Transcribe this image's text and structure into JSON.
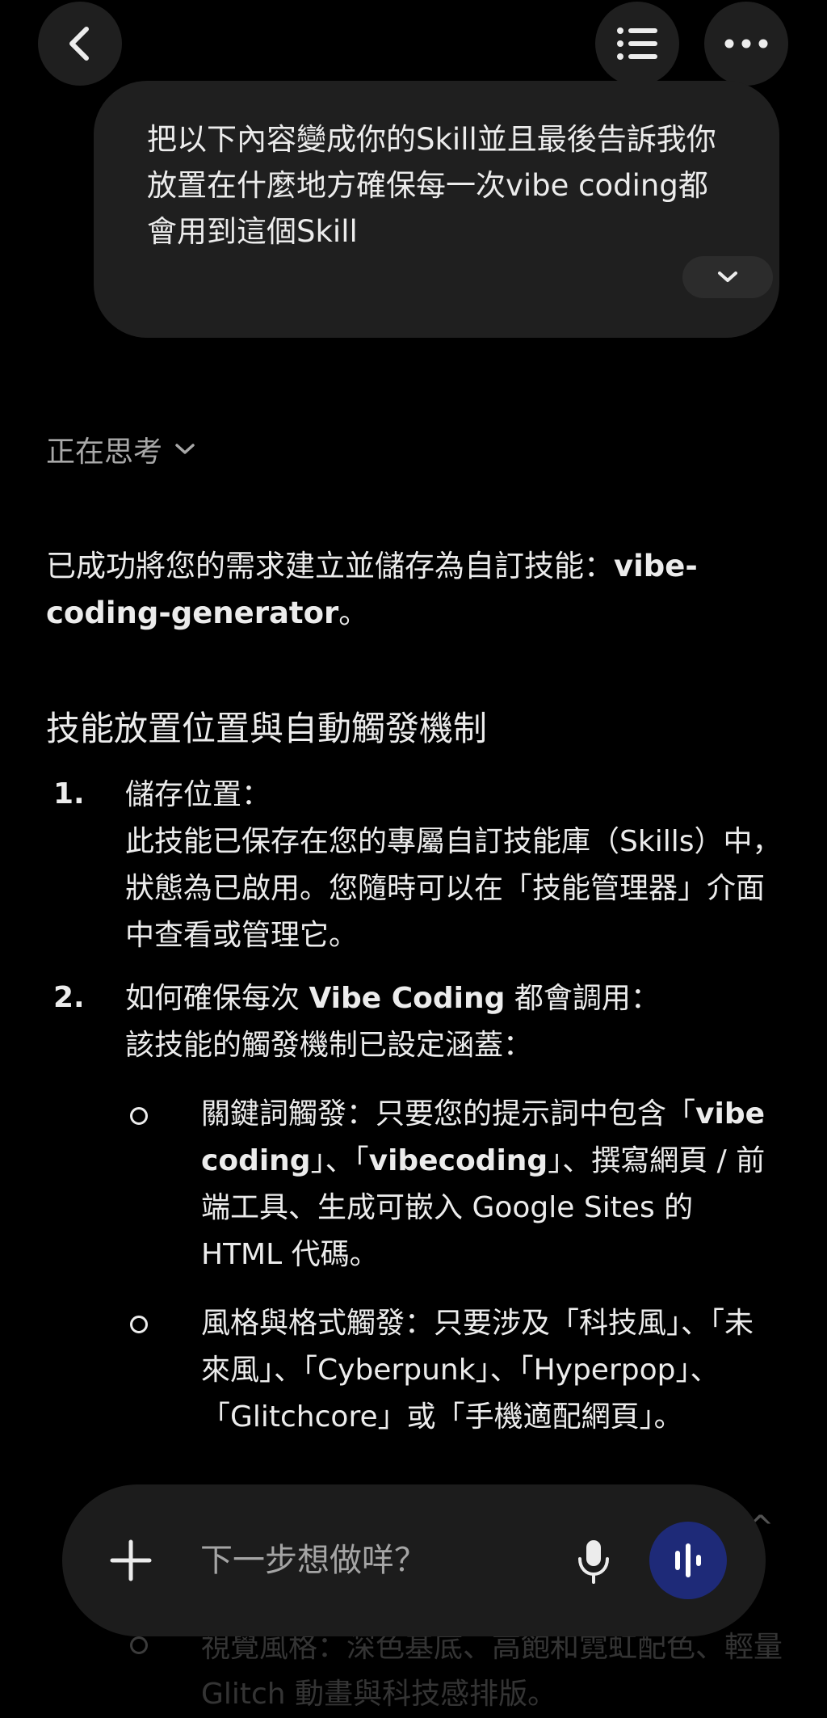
{
  "header": {
    "back_icon": "chevron-left-icon",
    "list_icon": "list-icon",
    "more_icon": "more-horizontal-icon"
  },
  "user_message": {
    "text": "把以下內容變成你的Skill並且最後告訴我你放置在什麼地方確保每一次vibe coding都會用到這個Skill",
    "expand_icon": "chevron-down-icon"
  },
  "thinking": {
    "label": "正在思考",
    "icon": "chevron-down-icon"
  },
  "response": {
    "intro_prefix": "已成功將您的需求建立並儲存為自訂技能：",
    "intro_bold": "vibe-coding-generator",
    "intro_suffix": "。",
    "section_title": "技能放置位置與自動觸發機制",
    "items": [
      {
        "number": "1.",
        "heading": "儲存位置：",
        "body": "此技能已保存在您的專屬自訂技能庫（Skills）中，狀態為已啟用。您隨時可以在「技能管理器」介面中查看或管理它。"
      },
      {
        "number": "2.",
        "heading_prefix": "如何確保每次 ",
        "heading_bold": "Vibe Coding",
        "heading_suffix": " 都會調用：",
        "body": "該技能的觸發機制已設定涵蓋："
      }
    ],
    "bullets": [
      {
        "label": "關鍵詞觸發：",
        "pre": "只要您的提示詞中包含「",
        "kw1": "vibe coding",
        "mid1": "」、「",
        "kw2": "vibecoding",
        "post": "」、撰寫網頁 / 前端工具、生成可嵌入 Google Sites 的 HTML 代碼。"
      },
      {
        "label": "風格與格式觸發：",
        "text": "只要涉及「科技風」、「未來風」、「Cyberpunk」、「Hyperpop」、「Glitchcore」或「手機適配網頁」。"
      }
    ],
    "partial_bullet": "視覺風格：深色基底、高飽和霓虹配色、輕量 Glitch 動畫與科技感排版。"
  },
  "composer": {
    "plus_icon": "plus-icon",
    "placeholder": "下一步想做咩？",
    "mic_icon": "mic-icon",
    "voice_icon": "voice-wave-icon"
  },
  "colors": {
    "background": "#000000",
    "surface": "#1f1f1f",
    "text": "#ececec",
    "muted": "#a8a8a8",
    "voice_button": "#1e2a78"
  }
}
